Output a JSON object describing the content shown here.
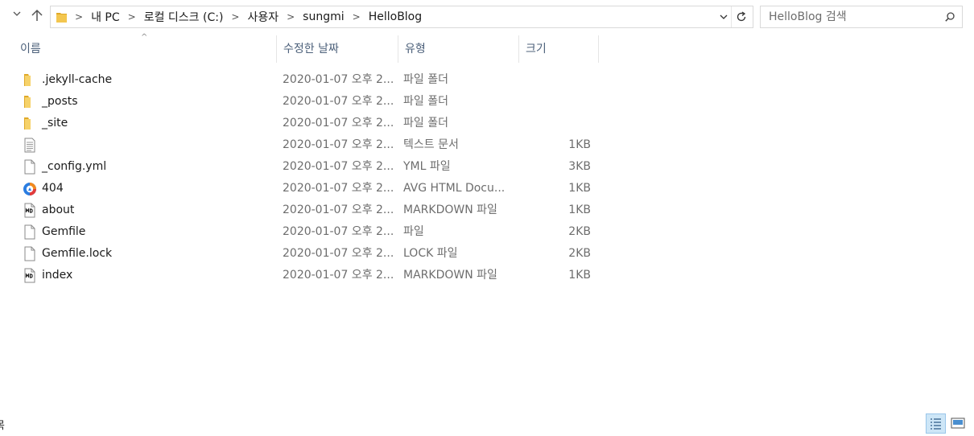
{
  "window": {
    "title": "HelloBlog"
  },
  "address": {
    "segments": [
      "내 PC",
      "로컬 디스크 (C:)",
      "사용자",
      "sungmi",
      "HelloBlog"
    ]
  },
  "search": {
    "placeholder": "HelloBlog 검색"
  },
  "columns": {
    "name": "이름",
    "date": "수정한 날짜",
    "type": "유형",
    "size": "크기"
  },
  "files": [
    {
      "icon": "folder-icon",
      "name": ".jekyll-cache",
      "date": "2020-01-07 오후 2...",
      "type": "파일 폴더",
      "size": ""
    },
    {
      "icon": "folder-icon",
      "name": "_posts",
      "date": "2020-01-07 오후 2...",
      "type": "파일 폴더",
      "size": ""
    },
    {
      "icon": "folder-icon",
      "name": "_site",
      "date": "2020-01-07 오후 2...",
      "type": "파일 폴더",
      "size": ""
    },
    {
      "icon": "text-document-icon",
      "name": "",
      "date": "2020-01-07 오후 2...",
      "type": "텍스트 문서",
      "size": "1KB"
    },
    {
      "icon": "file-icon",
      "name": "_config.yml",
      "date": "2020-01-07 오후 2...",
      "type": "YML 파일",
      "size": "3KB"
    },
    {
      "icon": "avg-browser-icon",
      "name": "404",
      "date": "2020-01-07 오후 2...",
      "type": "AVG HTML Docu...",
      "size": "1KB"
    },
    {
      "icon": "markdown-file-icon",
      "name": "about",
      "date": "2020-01-07 오후 2...",
      "type": "MARKDOWN 파일",
      "size": "1KB"
    },
    {
      "icon": "file-icon",
      "name": "Gemfile",
      "date": "2020-01-07 오후 2...",
      "type": "파일",
      "size": "2KB"
    },
    {
      "icon": "file-icon",
      "name": "Gemfile.lock",
      "date": "2020-01-07 오후 2...",
      "type": "LOCK 파일",
      "size": "2KB"
    },
    {
      "icon": "markdown-file-icon",
      "name": "index",
      "date": "2020-01-07 오후 2...",
      "type": "MARKDOWN 파일",
      "size": "1KB"
    }
  ],
  "status": {
    "text": "목"
  },
  "colors": {
    "folder": "#f3c64f",
    "header_text": "#4c607a",
    "view_selected": "#cde6f7"
  }
}
